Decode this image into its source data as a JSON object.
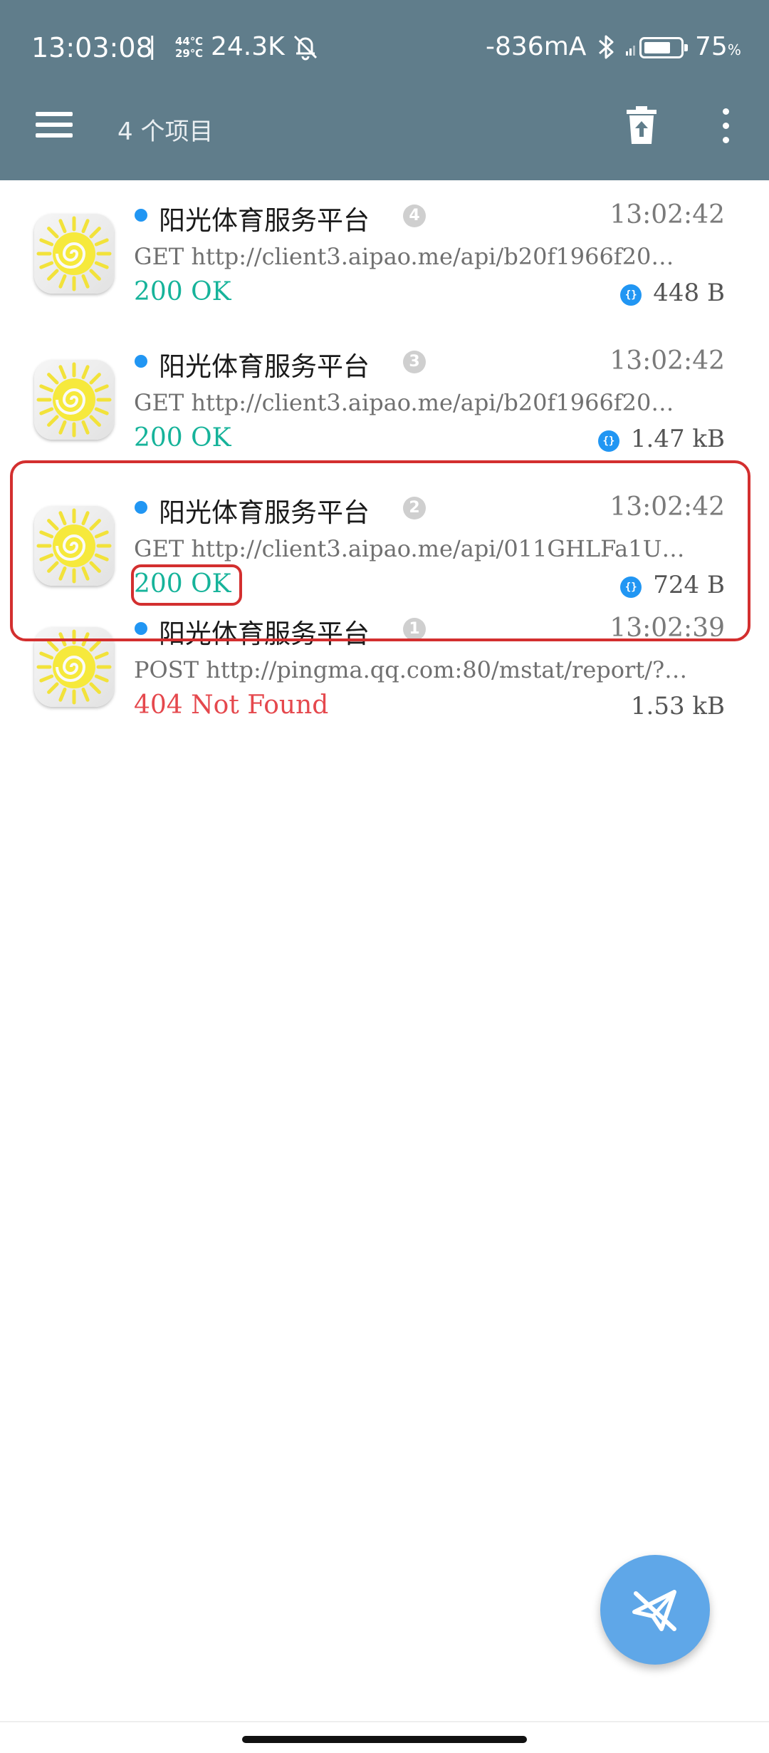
{
  "status_bar": {
    "time": "13:03:08",
    "separator": "|",
    "temp_top": "44℃",
    "temp_bottom": "29℃",
    "net_speed": "24.3K",
    "current": "-836mA",
    "battery_pct": "75",
    "battery_pct_suffix": "%",
    "battery_level": 0.75
  },
  "app_bar": {
    "title": "4 个项目",
    "menu_icon": "hamburger-menu-icon",
    "delete_icon": "trash-icon",
    "more_icon": "more-vert-icon"
  },
  "requests": [
    {
      "app": "阳光体育服务平台",
      "seq": "4",
      "time": "13:02:42",
      "url": "GET http://client3.aipao.me/api/b20f1966f20…",
      "status": "200 OK",
      "status_kind": "ok",
      "json": true,
      "size": "448 B"
    },
    {
      "app": "阳光体育服务平台",
      "seq": "3",
      "time": "13:02:42",
      "url": "GET http://client3.aipao.me/api/b20f1966f20…",
      "status": "200 OK",
      "status_kind": "ok",
      "json": true,
      "size": "1.47 kB"
    },
    {
      "app": "阳光体育服务平台",
      "seq": "2",
      "time": "13:02:42",
      "url": "GET http://client3.aipao.me/api/011GHLFa1U…",
      "status": "200 OK",
      "status_kind": "ok",
      "json": true,
      "size": "724 B"
    },
    {
      "app": "阳光体育服务平台",
      "seq": "1",
      "time": "13:02:39",
      "url": "POST http://pingma.qq.com:80/mstat/report/?…",
      "status": "404 Not Found",
      "status_kind": "err",
      "json": false,
      "size": "1.53 kB"
    }
  ],
  "json_badge_text": "{}",
  "fab": {
    "icon": "paper-plane-off-icon"
  },
  "colors": {
    "app_bar": "#607d8b",
    "ok": "#16b39a",
    "error": "#e5484d",
    "accent": "#2196f3",
    "highlight": "#d32f2f",
    "fab": "#5fa7e8"
  }
}
